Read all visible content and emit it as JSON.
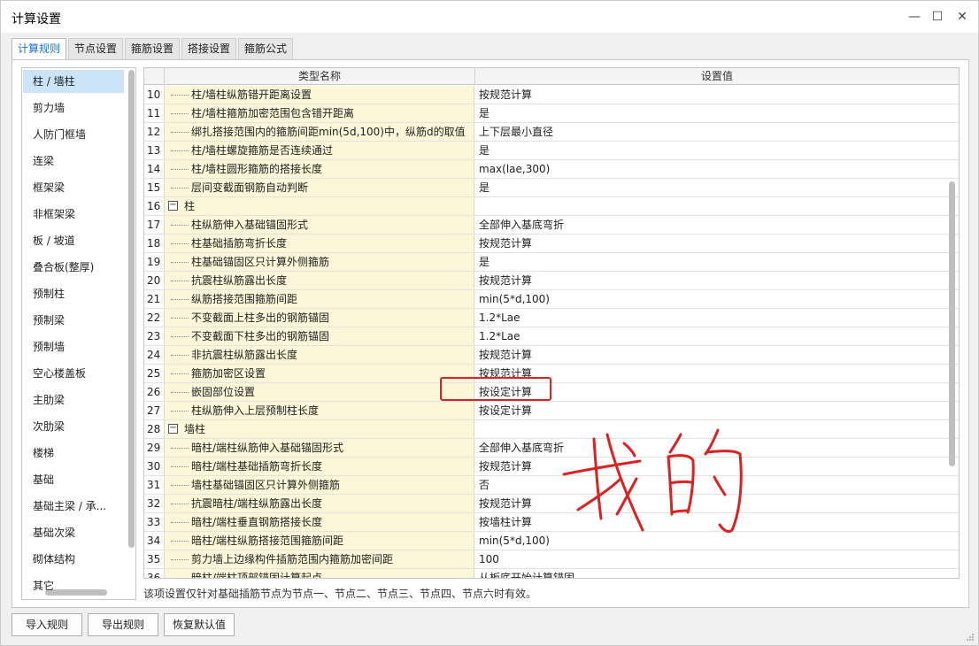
{
  "window": {
    "title": "计算设置",
    "controls": [
      "minimize",
      "maximize",
      "close"
    ]
  },
  "tabs": [
    {
      "label": "计算规则",
      "active": true
    },
    {
      "label": "节点设置",
      "active": false
    },
    {
      "label": "箍筋设置",
      "active": false
    },
    {
      "label": "搭接设置",
      "active": false
    },
    {
      "label": "箍筋公式",
      "active": false
    }
  ],
  "sidebar": {
    "items": [
      {
        "label": "柱 / 墙柱",
        "selected": true
      },
      {
        "label": "剪力墙"
      },
      {
        "label": "人防门框墙"
      },
      {
        "label": "连梁"
      },
      {
        "label": "框架梁"
      },
      {
        "label": "非框架梁"
      },
      {
        "label": "板 / 坡道"
      },
      {
        "label": "叠合板(整厚)"
      },
      {
        "label": "预制柱"
      },
      {
        "label": "预制梁"
      },
      {
        "label": "预制墙"
      },
      {
        "label": "空心楼盖板"
      },
      {
        "label": "主肋梁"
      },
      {
        "label": "次肋梁"
      },
      {
        "label": "楼梯"
      },
      {
        "label": "基础"
      },
      {
        "label": "基础主梁 / 承..."
      },
      {
        "label": "基础次梁"
      },
      {
        "label": "砌体结构"
      },
      {
        "label": "其它"
      }
    ]
  },
  "grid": {
    "headers": {
      "name": "类型名称",
      "value": "设置值"
    },
    "rows": [
      {
        "num": "10",
        "name": "柱/墙柱纵筋错开距离设置",
        "value": "按规范计算"
      },
      {
        "num": "11",
        "name": "柱/墙柱箍筋加密范围包含错开距离",
        "value": "是"
      },
      {
        "num": "12",
        "name": "绑扎搭接范围内的箍筋间距min(5d,100)中，纵筋d的取值",
        "value": "上下层最小直径"
      },
      {
        "num": "13",
        "name": "柱/墙柱螺旋箍筋是否连续通过",
        "value": "是"
      },
      {
        "num": "14",
        "name": "柱/墙柱圆形箍筋的搭接长度",
        "value": "max(lae,300)"
      },
      {
        "num": "15",
        "name": "层间变截面钢筋自动判断",
        "value": "是"
      },
      {
        "num": "16",
        "name": "柱",
        "value": "",
        "group": true
      },
      {
        "num": "17",
        "name": "柱纵筋伸入基础锚固形式",
        "value": "全部伸入基底弯折"
      },
      {
        "num": "18",
        "name": "柱基础插筋弯折长度",
        "value": "按规范计算"
      },
      {
        "num": "19",
        "name": "柱基础锚固区只计算外侧箍筋",
        "value": "是"
      },
      {
        "num": "20",
        "name": "抗震柱纵筋露出长度",
        "value": "按规范计算"
      },
      {
        "num": "21",
        "name": "纵筋搭接范围箍筋间距",
        "value": "min(5*d,100)"
      },
      {
        "num": "22",
        "name": "不变截面上柱多出的钢筋锚固",
        "value": "1.2*Lae"
      },
      {
        "num": "23",
        "name": "不变截面下柱多出的钢筋锚固",
        "value": "1.2*Lae"
      },
      {
        "num": "24",
        "name": "非抗震柱纵筋露出长度",
        "value": "按规范计算"
      },
      {
        "num": "25",
        "name": "箍筋加密区设置",
        "value": "按规范计算"
      },
      {
        "num": "26",
        "name": "嵌固部位设置",
        "value": "按设定计算"
      },
      {
        "num": "27",
        "name": "柱纵筋伸入上层预制柱长度",
        "value": "按设定计算"
      },
      {
        "num": "28",
        "name": "墙柱",
        "value": "",
        "group": true
      },
      {
        "num": "29",
        "name": "暗柱/端柱纵筋伸入基础锚固形式",
        "value": "全部伸入基底弯折"
      },
      {
        "num": "30",
        "name": "暗柱/端柱基础插筋弯折长度",
        "value": "按规范计算"
      },
      {
        "num": "31",
        "name": "墙柱基础锚固区只计算外侧箍筋",
        "value": "否"
      },
      {
        "num": "32",
        "name": "抗震暗柱/端柱纵筋露出长度",
        "value": "按规范计算"
      },
      {
        "num": "33",
        "name": "暗柱/端柱垂直钢筋搭接长度",
        "value": "按墙柱计算"
      },
      {
        "num": "34",
        "name": "暗柱/端柱纵筋搭接范围箍筋间距",
        "value": "min(5*d,100)"
      },
      {
        "num": "35",
        "name": "剪力墙上边缘构件插筋范围内箍筋加密间距",
        "value": "100"
      },
      {
        "num": "36",
        "name": "暗柱/端柱顶部锚固计算起点",
        "value": "从板底开始计算锚固"
      }
    ]
  },
  "description": "该项设置仅针对基础插筋节点为节点一、节点二、节点三、节点四、节点六时有效。",
  "buttons": {
    "import": "导入规则",
    "export": "导出规则",
    "reset": "恢复默认值"
  },
  "annotation": {
    "handwriting": "我的",
    "color": "#e02020"
  },
  "colors": {
    "name_column_bg": "#fbf7d8",
    "selected_bg": "#cce4f7",
    "active_tab_text": "#1f6fd0"
  }
}
